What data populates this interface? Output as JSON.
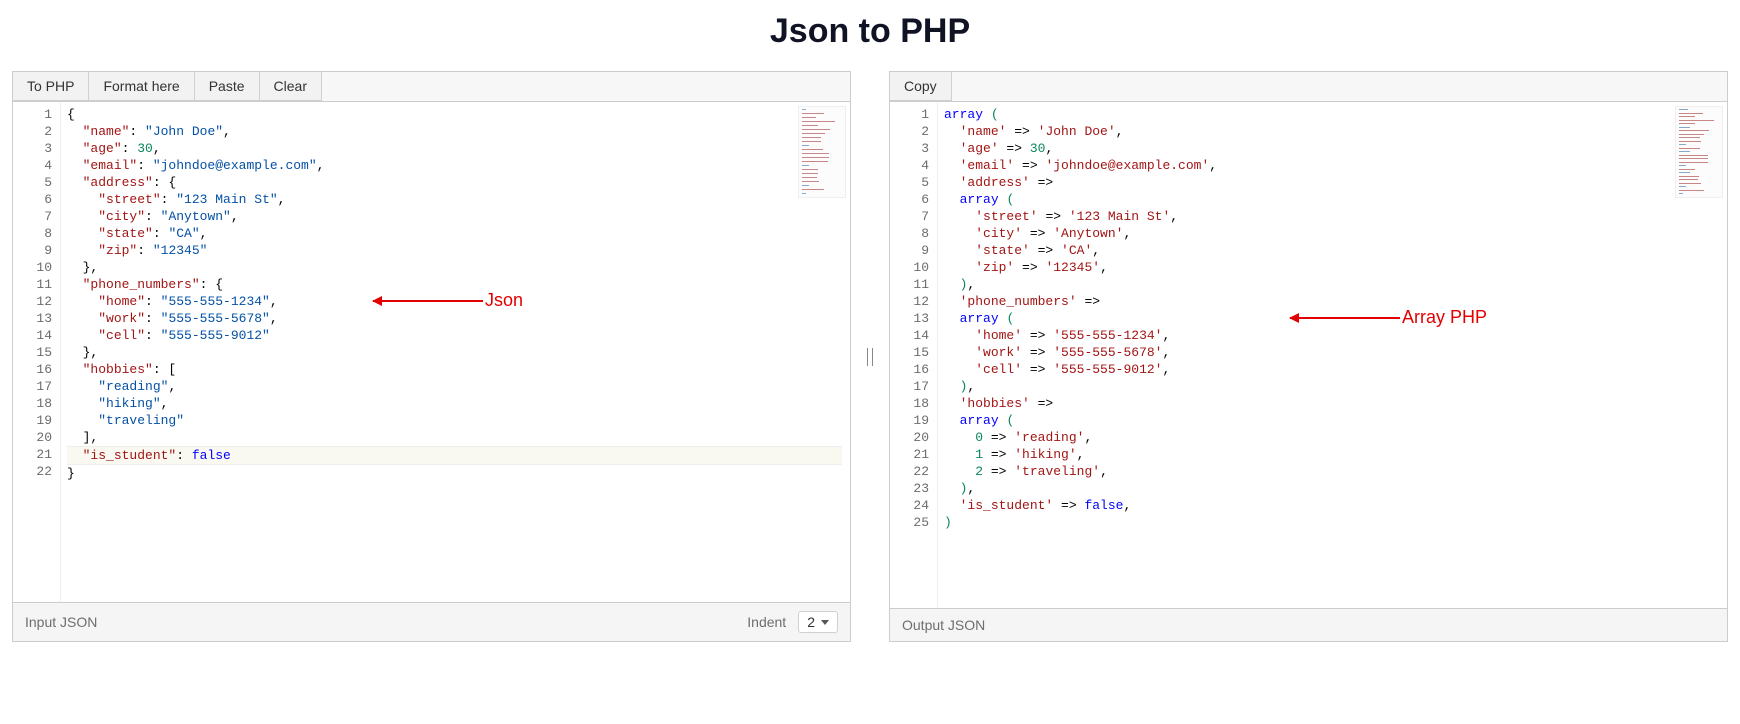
{
  "title": "Json to PHP",
  "leftPanel": {
    "toolbar": {
      "toPhp": "To PHP",
      "formatHere": "Format here",
      "paste": "Paste",
      "clear": "Clear"
    },
    "activeLine": 21,
    "code": {
      "lines": [
        {
          "n": 1,
          "indent": 0,
          "tokens": [
            {
              "t": "punct",
              "v": "{"
            }
          ]
        },
        {
          "n": 2,
          "indent": 1,
          "tokens": [
            {
              "t": "key",
              "v": "\"name\""
            },
            {
              "t": "punct",
              "v": ": "
            },
            {
              "t": "str",
              "v": "\"John Doe\""
            },
            {
              "t": "punct",
              "v": ","
            }
          ]
        },
        {
          "n": 3,
          "indent": 1,
          "tokens": [
            {
              "t": "key",
              "v": "\"age\""
            },
            {
              "t": "punct",
              "v": ": "
            },
            {
              "t": "num",
              "v": "30"
            },
            {
              "t": "punct",
              "v": ","
            }
          ]
        },
        {
          "n": 4,
          "indent": 1,
          "tokens": [
            {
              "t": "key",
              "v": "\"email\""
            },
            {
              "t": "punct",
              "v": ": "
            },
            {
              "t": "str",
              "v": "\"johndoe@example.com\""
            },
            {
              "t": "punct",
              "v": ","
            }
          ]
        },
        {
          "n": 5,
          "indent": 1,
          "tokens": [
            {
              "t": "key",
              "v": "\"address\""
            },
            {
              "t": "punct",
              "v": ": {"
            }
          ]
        },
        {
          "n": 6,
          "indent": 2,
          "tokens": [
            {
              "t": "key",
              "v": "\"street\""
            },
            {
              "t": "punct",
              "v": ": "
            },
            {
              "t": "str",
              "v": "\"123 Main St\""
            },
            {
              "t": "punct",
              "v": ","
            }
          ]
        },
        {
          "n": 7,
          "indent": 2,
          "tokens": [
            {
              "t": "key",
              "v": "\"city\""
            },
            {
              "t": "punct",
              "v": ": "
            },
            {
              "t": "str",
              "v": "\"Anytown\""
            },
            {
              "t": "punct",
              "v": ","
            }
          ]
        },
        {
          "n": 8,
          "indent": 2,
          "tokens": [
            {
              "t": "key",
              "v": "\"state\""
            },
            {
              "t": "punct",
              "v": ": "
            },
            {
              "t": "str",
              "v": "\"CA\""
            },
            {
              "t": "punct",
              "v": ","
            }
          ]
        },
        {
          "n": 9,
          "indent": 2,
          "tokens": [
            {
              "t": "key",
              "v": "\"zip\""
            },
            {
              "t": "punct",
              "v": ": "
            },
            {
              "t": "str",
              "v": "\"12345\""
            }
          ]
        },
        {
          "n": 10,
          "indent": 1,
          "tokens": [
            {
              "t": "punct",
              "v": "},"
            }
          ]
        },
        {
          "n": 11,
          "indent": 1,
          "tokens": [
            {
              "t": "key",
              "v": "\"phone_numbers\""
            },
            {
              "t": "punct",
              "v": ": {"
            }
          ]
        },
        {
          "n": 12,
          "indent": 2,
          "tokens": [
            {
              "t": "key",
              "v": "\"home\""
            },
            {
              "t": "punct",
              "v": ": "
            },
            {
              "t": "str",
              "v": "\"555-555-1234\""
            },
            {
              "t": "punct",
              "v": ","
            }
          ]
        },
        {
          "n": 13,
          "indent": 2,
          "tokens": [
            {
              "t": "key",
              "v": "\"work\""
            },
            {
              "t": "punct",
              "v": ": "
            },
            {
              "t": "str",
              "v": "\"555-555-5678\""
            },
            {
              "t": "punct",
              "v": ","
            }
          ]
        },
        {
          "n": 14,
          "indent": 2,
          "tokens": [
            {
              "t": "key",
              "v": "\"cell\""
            },
            {
              "t": "punct",
              "v": ": "
            },
            {
              "t": "str",
              "v": "\"555-555-9012\""
            }
          ]
        },
        {
          "n": 15,
          "indent": 1,
          "tokens": [
            {
              "t": "punct",
              "v": "},"
            }
          ]
        },
        {
          "n": 16,
          "indent": 1,
          "tokens": [
            {
              "t": "key",
              "v": "\"hobbies\""
            },
            {
              "t": "punct",
              "v": ": ["
            }
          ]
        },
        {
          "n": 17,
          "indent": 2,
          "tokens": [
            {
              "t": "str",
              "v": "\"reading\""
            },
            {
              "t": "punct",
              "v": ","
            }
          ]
        },
        {
          "n": 18,
          "indent": 2,
          "tokens": [
            {
              "t": "str",
              "v": "\"hiking\""
            },
            {
              "t": "punct",
              "v": ","
            }
          ]
        },
        {
          "n": 19,
          "indent": 2,
          "tokens": [
            {
              "t": "str",
              "v": "\"traveling\""
            }
          ]
        },
        {
          "n": 20,
          "indent": 1,
          "tokens": [
            {
              "t": "punct",
              "v": "],"
            }
          ]
        },
        {
          "n": 21,
          "indent": 1,
          "tokens": [
            {
              "t": "key",
              "v": "\"is_student\""
            },
            {
              "t": "punct",
              "v": ": "
            },
            {
              "t": "kw",
              "v": "false"
            }
          ]
        },
        {
          "n": 22,
          "indent": 0,
          "tokens": [
            {
              "t": "punct",
              "v": "}"
            }
          ]
        }
      ]
    },
    "footer": {
      "label": "Input JSON",
      "indentLabel": "Indent",
      "indentValue": "2"
    },
    "annotation": {
      "label": "Json",
      "topLine": 12,
      "arrowWidth": 110,
      "leftOffset": 360
    }
  },
  "rightPanel": {
    "toolbar": {
      "copy": "Copy"
    },
    "code": {
      "lines": [
        {
          "n": 1,
          "indent": 0,
          "tokens": [
            {
              "t": "kw",
              "v": "array"
            },
            {
              "t": "op",
              "v": " "
            },
            {
              "t": "par",
              "v": "("
            }
          ]
        },
        {
          "n": 2,
          "indent": 1,
          "tokens": [
            {
              "t": "str",
              "v": "'name'"
            },
            {
              "t": "op",
              "v": " => "
            },
            {
              "t": "str",
              "v": "'John Doe'"
            },
            {
              "t": "op",
              "v": ","
            }
          ]
        },
        {
          "n": 3,
          "indent": 1,
          "tokens": [
            {
              "t": "str",
              "v": "'age'"
            },
            {
              "t": "op",
              "v": " => "
            },
            {
              "t": "num",
              "v": "30"
            },
            {
              "t": "op",
              "v": ","
            }
          ]
        },
        {
          "n": 4,
          "indent": 1,
          "tokens": [
            {
              "t": "str",
              "v": "'email'"
            },
            {
              "t": "op",
              "v": " => "
            },
            {
              "t": "str",
              "v": "'johndoe@example.com'"
            },
            {
              "t": "op",
              "v": ","
            }
          ]
        },
        {
          "n": 5,
          "indent": 1,
          "tokens": [
            {
              "t": "str",
              "v": "'address'"
            },
            {
              "t": "op",
              "v": " =>"
            }
          ]
        },
        {
          "n": 6,
          "indent": 1,
          "tokens": [
            {
              "t": "kw",
              "v": "array"
            },
            {
              "t": "op",
              "v": " "
            },
            {
              "t": "par",
              "v": "("
            }
          ]
        },
        {
          "n": 7,
          "indent": 2,
          "tokens": [
            {
              "t": "str",
              "v": "'street'"
            },
            {
              "t": "op",
              "v": " => "
            },
            {
              "t": "str",
              "v": "'123 Main St'"
            },
            {
              "t": "op",
              "v": ","
            }
          ]
        },
        {
          "n": 8,
          "indent": 2,
          "tokens": [
            {
              "t": "str",
              "v": "'city'"
            },
            {
              "t": "op",
              "v": " => "
            },
            {
              "t": "str",
              "v": "'Anytown'"
            },
            {
              "t": "op",
              "v": ","
            }
          ]
        },
        {
          "n": 9,
          "indent": 2,
          "tokens": [
            {
              "t": "str",
              "v": "'state'"
            },
            {
              "t": "op",
              "v": " => "
            },
            {
              "t": "str",
              "v": "'CA'"
            },
            {
              "t": "op",
              "v": ","
            }
          ]
        },
        {
          "n": 10,
          "indent": 2,
          "tokens": [
            {
              "t": "str",
              "v": "'zip'"
            },
            {
              "t": "op",
              "v": " => "
            },
            {
              "t": "str",
              "v": "'12345'"
            },
            {
              "t": "op",
              "v": ","
            }
          ]
        },
        {
          "n": 11,
          "indent": 1,
          "tokens": [
            {
              "t": "par",
              "v": ")"
            },
            {
              "t": "op",
              "v": ","
            }
          ]
        },
        {
          "n": 12,
          "indent": 1,
          "tokens": [
            {
              "t": "str",
              "v": "'phone_numbers'"
            },
            {
              "t": "op",
              "v": " =>"
            }
          ]
        },
        {
          "n": 13,
          "indent": 1,
          "tokens": [
            {
              "t": "kw",
              "v": "array"
            },
            {
              "t": "op",
              "v": " "
            },
            {
              "t": "par",
              "v": "("
            }
          ]
        },
        {
          "n": 14,
          "indent": 2,
          "tokens": [
            {
              "t": "str",
              "v": "'home'"
            },
            {
              "t": "op",
              "v": " => "
            },
            {
              "t": "str",
              "v": "'555-555-1234'"
            },
            {
              "t": "op",
              "v": ","
            }
          ]
        },
        {
          "n": 15,
          "indent": 2,
          "tokens": [
            {
              "t": "str",
              "v": "'work'"
            },
            {
              "t": "op",
              "v": " => "
            },
            {
              "t": "str",
              "v": "'555-555-5678'"
            },
            {
              "t": "op",
              "v": ","
            }
          ]
        },
        {
          "n": 16,
          "indent": 2,
          "tokens": [
            {
              "t": "str",
              "v": "'cell'"
            },
            {
              "t": "op",
              "v": " => "
            },
            {
              "t": "str",
              "v": "'555-555-9012'"
            },
            {
              "t": "op",
              "v": ","
            }
          ]
        },
        {
          "n": 17,
          "indent": 1,
          "tokens": [
            {
              "t": "par",
              "v": ")"
            },
            {
              "t": "op",
              "v": ","
            }
          ]
        },
        {
          "n": 18,
          "indent": 1,
          "tokens": [
            {
              "t": "str",
              "v": "'hobbies'"
            },
            {
              "t": "op",
              "v": " =>"
            }
          ]
        },
        {
          "n": 19,
          "indent": 1,
          "tokens": [
            {
              "t": "kw",
              "v": "array"
            },
            {
              "t": "op",
              "v": " "
            },
            {
              "t": "par",
              "v": "("
            }
          ]
        },
        {
          "n": 20,
          "indent": 2,
          "tokens": [
            {
              "t": "num",
              "v": "0"
            },
            {
              "t": "op",
              "v": " => "
            },
            {
              "t": "str",
              "v": "'reading'"
            },
            {
              "t": "op",
              "v": ","
            }
          ]
        },
        {
          "n": 21,
          "indent": 2,
          "tokens": [
            {
              "t": "num",
              "v": "1"
            },
            {
              "t": "op",
              "v": " => "
            },
            {
              "t": "str",
              "v": "'hiking'"
            },
            {
              "t": "op",
              "v": ","
            }
          ]
        },
        {
          "n": 22,
          "indent": 2,
          "tokens": [
            {
              "t": "num",
              "v": "2"
            },
            {
              "t": "op",
              "v": " => "
            },
            {
              "t": "str",
              "v": "'traveling'"
            },
            {
              "t": "op",
              "v": ","
            }
          ]
        },
        {
          "n": 23,
          "indent": 1,
          "tokens": [
            {
              "t": "par",
              "v": ")"
            },
            {
              "t": "op",
              "v": ","
            }
          ]
        },
        {
          "n": 24,
          "indent": 1,
          "tokens": [
            {
              "t": "str",
              "v": "'is_student'"
            },
            {
              "t": "op",
              "v": " => "
            },
            {
              "t": "kw",
              "v": "false"
            },
            {
              "t": "op",
              "v": ","
            }
          ]
        },
        {
          "n": 25,
          "indent": 0,
          "tokens": [
            {
              "t": "par",
              "v": ")"
            }
          ]
        }
      ]
    },
    "footer": {
      "label": "Output JSON"
    },
    "annotation": {
      "label": "Array PHP",
      "topLine": 13,
      "arrowWidth": 110,
      "leftOffset": 400
    }
  }
}
